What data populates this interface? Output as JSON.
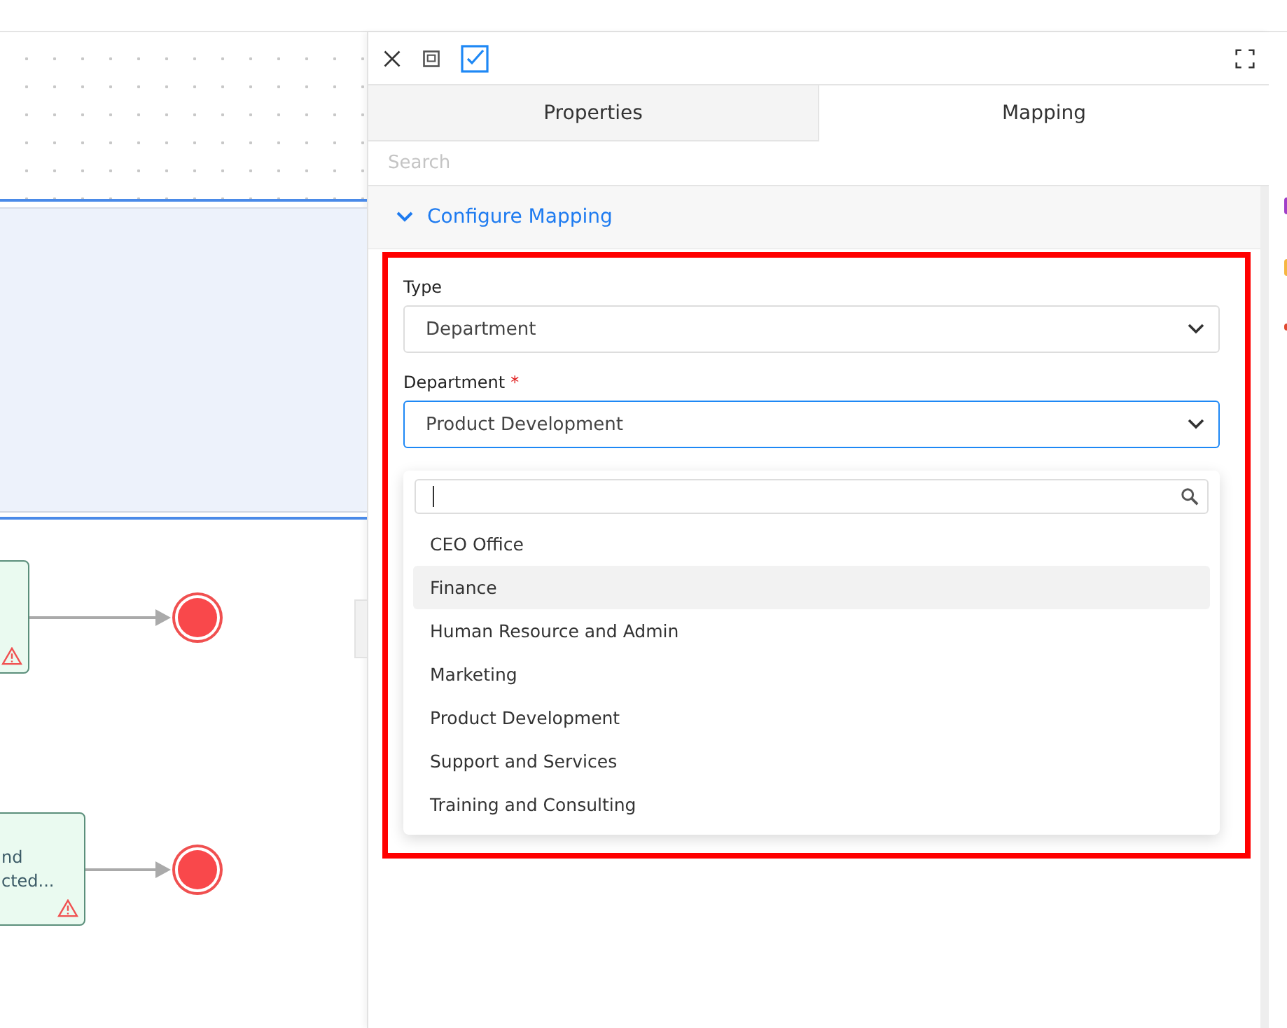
{
  "diagram": {
    "nodes": [
      {
        "warning": true
      },
      {
        "lines": [
          "nd",
          "cted..."
        ],
        "warning": true
      }
    ]
  },
  "panel": {
    "tabs": [
      {
        "label": "Properties",
        "selected": false
      },
      {
        "label": "Mapping",
        "selected": true
      }
    ],
    "search": {
      "placeholder": "Search"
    },
    "section": {
      "title": "Configure Mapping",
      "expanded": true
    },
    "fields": [
      {
        "label": "Type",
        "value": "Department",
        "focused": false
      },
      {
        "label": "Department",
        "required_mark": "*",
        "value": "Product Development",
        "focused": true
      }
    ],
    "dropdown": {
      "options": [
        {
          "label": "CEO Office",
          "highlighted": false
        },
        {
          "label": "Finance",
          "highlighted": true
        },
        {
          "label": "Human Resource and Admin",
          "highlighted": false
        },
        {
          "label": "Marketing",
          "highlighted": false
        },
        {
          "label": "Product Development",
          "highlighted": false
        },
        {
          "label": "Support and Services",
          "highlighted": false
        },
        {
          "label": "Training and Consulting",
          "highlighted": false
        }
      ]
    }
  }
}
